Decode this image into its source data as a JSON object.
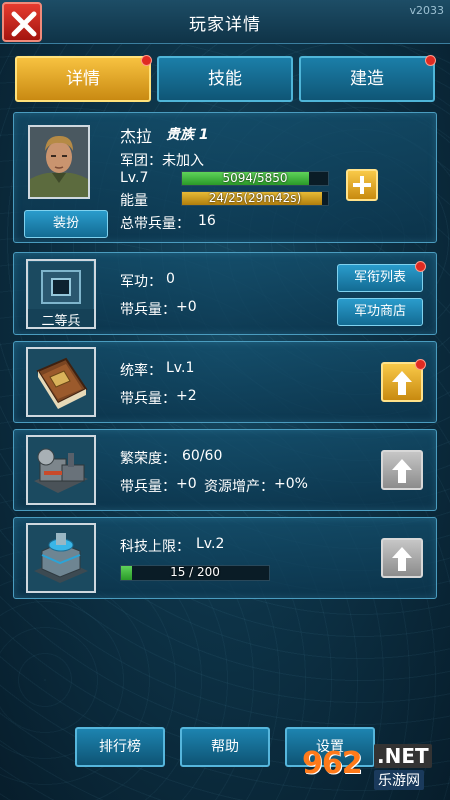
{
  "header": {
    "title": "玩家详情",
    "version": "v2033"
  },
  "tabs": [
    {
      "label": "详情",
      "active": true,
      "notify": true
    },
    {
      "label": "技能",
      "active": false,
      "notify": false
    },
    {
      "label": "建造",
      "active": false,
      "notify": true
    }
  ],
  "profile": {
    "name": "杰拉",
    "rank": "贵族 1",
    "legion_label": "军团：",
    "legion_value": "未加入",
    "level": "Lv.7",
    "exp_text": "5094/5850",
    "exp_fraction": 0.8708,
    "energy_label": "能量",
    "energy_text": "24/25(29m42s)",
    "energy_fraction": 0.96,
    "total_troops_label": "总带兵量：",
    "total_troops_value": "16",
    "dress_button": "装扮"
  },
  "military": {
    "badge_label": "二等兵",
    "merit_label": "军功：",
    "merit_value": "0",
    "troops_label": "带兵量：",
    "troops_value": "+0",
    "rank_list_button": "军衔列表",
    "rank_list_notify": true,
    "merit_shop_button": "军功商店"
  },
  "command": {
    "label": "统率：",
    "value": "Lv.1",
    "troops_label": "带兵量：",
    "troops_value": "+2",
    "upgrade_available": true,
    "notify": true
  },
  "prosperity": {
    "label": "繁荣度：",
    "value": "60/60",
    "troops_label": "带兵量：",
    "troops_value": "+0",
    "resource_label": "资源增产：",
    "resource_value": "+0%",
    "upgrade_available": false
  },
  "tech": {
    "label": "科技上限：",
    "value": "Lv.2",
    "progress_text": "15 / 200",
    "progress_fraction": 0.075,
    "upgrade_available": false
  },
  "bottom": {
    "ranking": "排行榜",
    "help": "帮助",
    "settings": "设置"
  },
  "watermark": {
    "logo": "962",
    "net": ".NET",
    "sub": "乐游网"
  },
  "colors": {
    "accent_gold": "#f1c232",
    "exp_bar": "#3cb93a",
    "energy_bar": "#d4a21a",
    "tech_bar": "#3cb93a",
    "notify_red": "#e02a22"
  }
}
